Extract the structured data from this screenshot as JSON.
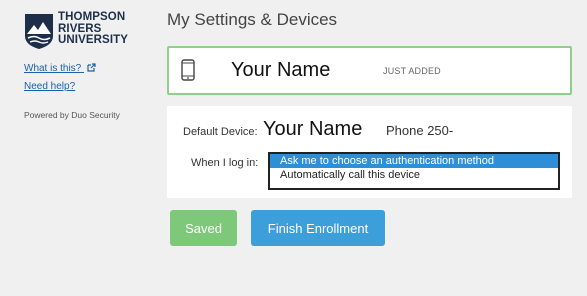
{
  "sidebar": {
    "logo_lines": [
      "THOMPSON",
      "RIVERS",
      "UNIVERSITY"
    ],
    "what_is_this": "What is this?",
    "need_help": "Need help?",
    "powered_by": "Powered by Duo Security"
  },
  "main": {
    "title": "My Settings & Devices",
    "device": {
      "name": "Your Name",
      "status": "JUST ADDED",
      "icon": "phone-icon"
    },
    "settings": {
      "default_device_label": "Default Device:",
      "default_device_name": "Your Name",
      "default_device_phone": "Phone 250-",
      "when_login_label": "When I log in:",
      "options": [
        "Ask me to choose an authentication method",
        "Automatically call this device"
      ],
      "selected_option": "Ask me to choose an authentication method"
    },
    "buttons": {
      "saved": "Saved",
      "finish": "Finish Enrollment"
    }
  },
  "colors": {
    "saved_button": "#7ec87a",
    "finish_button": "#3d9fd9",
    "device_border": "#8fcf8a",
    "selected_option": "#2e8fd6",
    "link": "#1a5fa8"
  }
}
